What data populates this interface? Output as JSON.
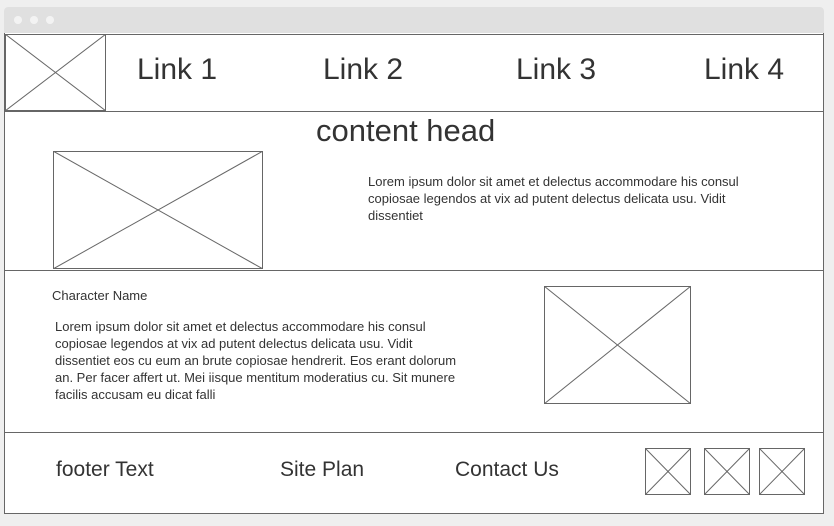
{
  "nav": {
    "links": [
      "Link 1",
      "Link 2",
      "Link 3",
      "Link 4"
    ]
  },
  "content": {
    "head": "content head",
    "intro": "Lorem ipsum dolor sit amet et delectus accommodare his consul copiosae legendos at vix ad putent delectus delicata usu. Vidit dissentiet"
  },
  "character": {
    "name": "Character Name",
    "bio": "Lorem ipsum dolor sit amet et delectus accommodare his consul copiosae legendos at vix ad putent delectus delicata usu. Vidit dissentiet eos cu eum an brute copiosae hendrerit. Eos erant dolorum an. Per facer affert ut. Mei iisque mentitum moderatius cu. Sit munere facilis accusam eu dicat falli"
  },
  "footer": {
    "text": "footer Text",
    "site_plan": "Site Plan",
    "contact": "Contact Us"
  }
}
